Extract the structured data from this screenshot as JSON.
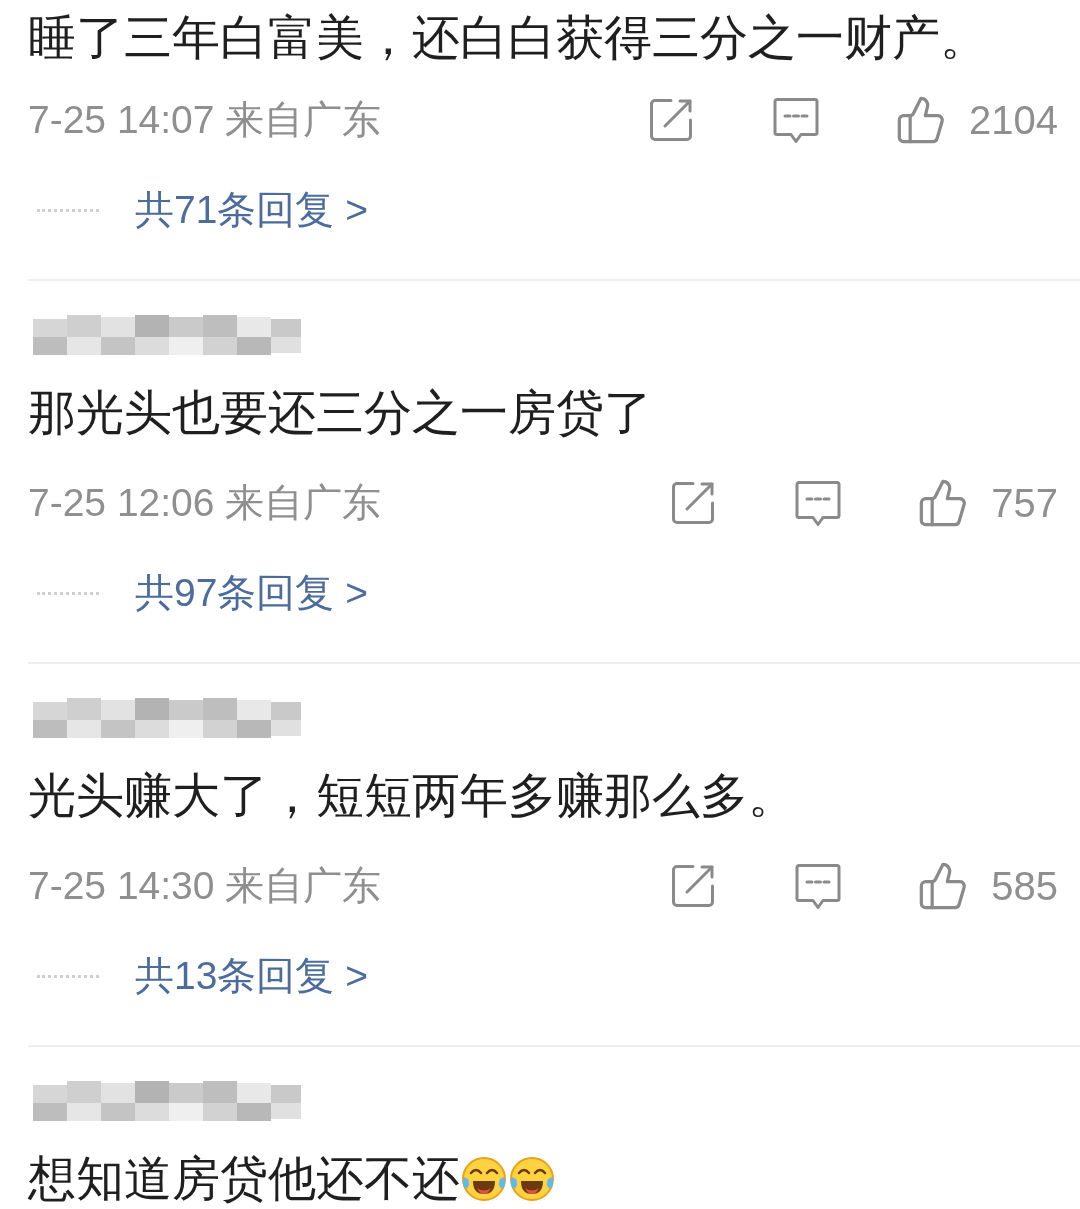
{
  "comments": [
    {
      "text": "睡了三年白富美，还白白获得三分之一财产。",
      "time": "7-25 14:07",
      "location": "来自广东",
      "likes": "2104",
      "replies_link": "共71条回复 >"
    },
    {
      "username_blurred": true,
      "text": "那光头也要还三分之一房贷了",
      "time": "7-25 12:06",
      "location": "来自广东",
      "likes": "757",
      "replies_link": "共97条回复 >"
    },
    {
      "username_blurred": true,
      "text": "光头赚大了，短短两年多赚那么多。",
      "time": "7-25 14:30",
      "location": "来自广东",
      "likes": "585",
      "replies_link": "共13条回复 >"
    },
    {
      "username_blurred": true,
      "text": "想知道房贷他还不还",
      "emoji": [
        {
          "kind": "laughing_crying"
        },
        {
          "kind": "laughing_crying"
        }
      ]
    }
  ]
}
